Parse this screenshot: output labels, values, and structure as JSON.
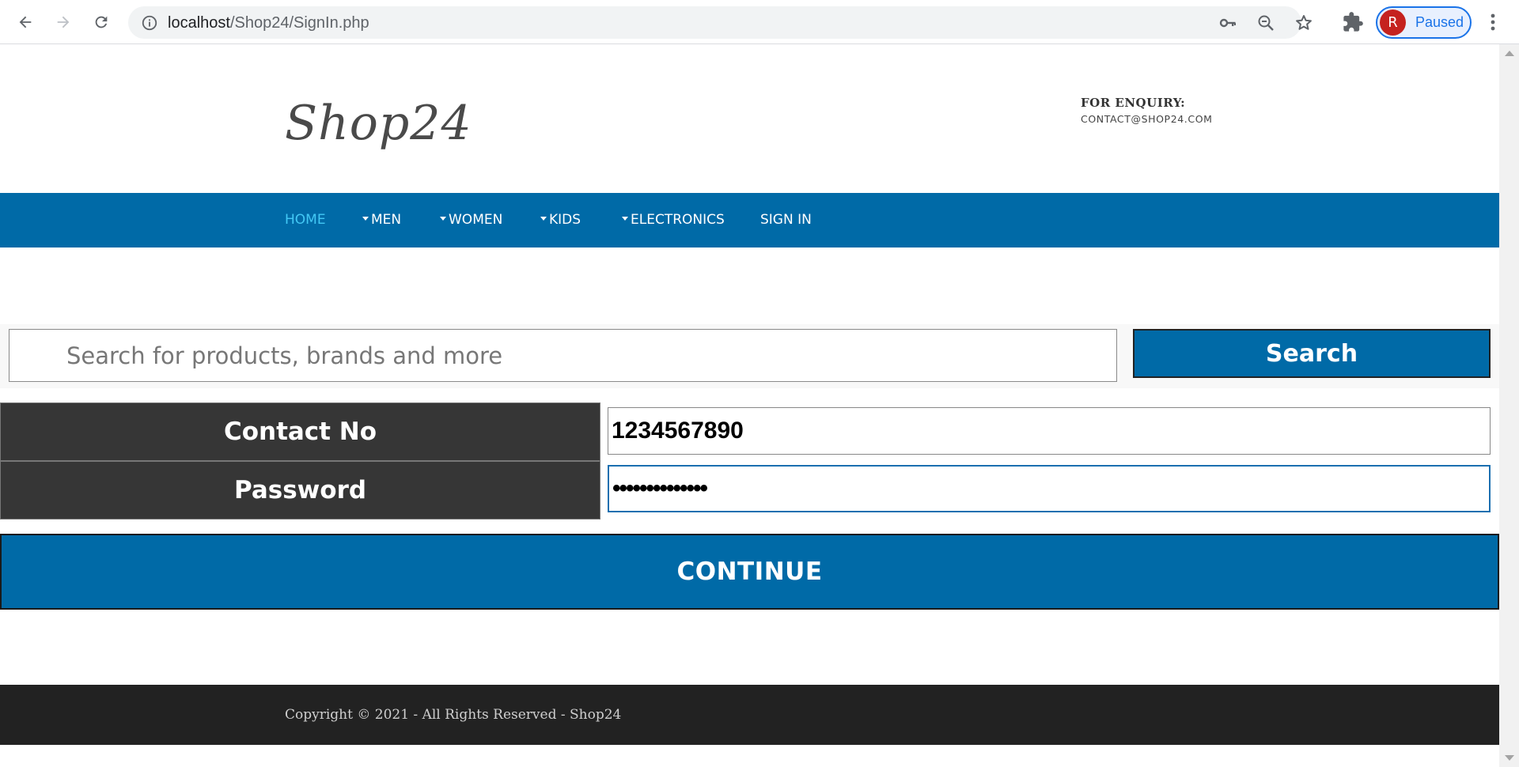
{
  "browser": {
    "url_host": "localhost",
    "url_path": "/Shop24/SignIn.php",
    "profile_initial": "R",
    "profile_status": "Paused",
    "icons": [
      "back-arrow-icon",
      "forward-arrow-icon",
      "reload-icon",
      "info-icon",
      "key-icon",
      "zoom-out-icon",
      "star-icon",
      "extensions-icon",
      "more-vert-icon"
    ]
  },
  "header": {
    "logo": "Shop24",
    "enquiry_label": "FOR ENQUIRY:",
    "enquiry_email": "CONTACT@SHOP24.COM"
  },
  "nav": {
    "items": [
      {
        "label": "HOME",
        "dropdown": false,
        "active": true
      },
      {
        "label": "MEN",
        "dropdown": true,
        "active": false
      },
      {
        "label": "WOMEN",
        "dropdown": true,
        "active": false
      },
      {
        "label": "KIDS",
        "dropdown": true,
        "active": false
      },
      {
        "label": "ELECTRONICS",
        "dropdown": true,
        "active": false
      },
      {
        "label": "SIGN IN",
        "dropdown": false,
        "active": false
      }
    ]
  },
  "search": {
    "placeholder": "Search for products, brands and more",
    "value": "",
    "button_label": "Search"
  },
  "signin": {
    "contact_label": "Contact No",
    "contact_value": "1234567890",
    "password_label": "Password",
    "password_value": "••••••••••••••",
    "continue_label": "CONTINUE"
  },
  "footer": {
    "copyright": "Copyright © 2021 - All Rights Reserved - Shop24"
  },
  "colors": {
    "brand_blue": "#006aa7",
    "nav_active": "#42c8f5",
    "label_dark": "#363636",
    "footer_dark": "#222222"
  }
}
